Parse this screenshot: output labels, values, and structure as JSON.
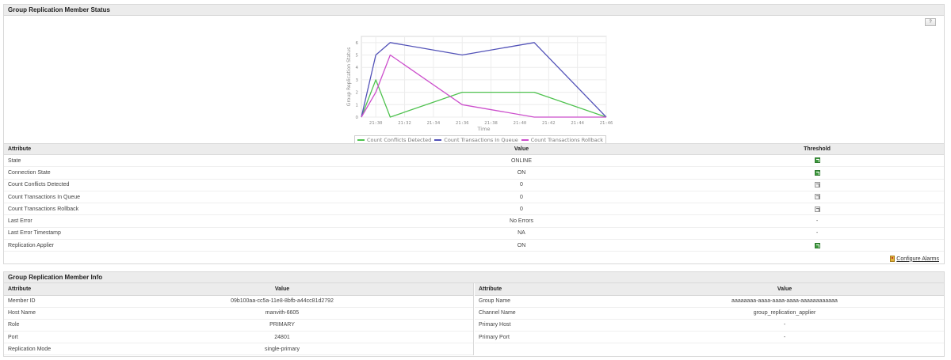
{
  "status_panel": {
    "title": "Group Replication Member Status",
    "export_label": "?"
  },
  "chart_data": {
    "type": "line",
    "ylabel": "Group Replication Status",
    "xlabel": "Time",
    "x_ticks": [
      "21:30",
      "21:32",
      "21:34",
      "21:36",
      "21:38",
      "21:40",
      "21:42",
      "21:44",
      "21:46"
    ],
    "y_ticks": [
      0,
      1,
      2,
      3,
      4,
      5,
      6
    ],
    "ylim": [
      0,
      6.5
    ],
    "x_range_minutes": [
      "21:29",
      "21:46"
    ],
    "grid": true,
    "legend_position": "bottom",
    "series": [
      {
        "name": "Count Conflicts Detected",
        "color": "#4fc24f",
        "points": [
          [
            "21:29",
            0
          ],
          [
            "21:30",
            3
          ],
          [
            "21:31",
            0
          ],
          [
            "21:36",
            2
          ],
          [
            "21:41",
            2
          ],
          [
            "21:46",
            0
          ]
        ]
      },
      {
        "name": "Count Transactions In Queue",
        "color": "#5252b8",
        "points": [
          [
            "21:29",
            0
          ],
          [
            "21:30",
            5
          ],
          [
            "21:31",
            6
          ],
          [
            "21:36",
            5
          ],
          [
            "21:41",
            6
          ],
          [
            "21:46",
            0
          ]
        ]
      },
      {
        "name": "Count Transactions Rollback",
        "color": "#cc4fcc",
        "points": [
          [
            "21:29",
            0
          ],
          [
            "21:30",
            2
          ],
          [
            "21:31",
            5
          ],
          [
            "21:36",
            1
          ],
          [
            "21:41",
            0
          ],
          [
            "21:46",
            0
          ]
        ]
      }
    ]
  },
  "status_table": {
    "headers": {
      "attribute": "Attribute",
      "value": "Value",
      "threshold": "Threshold"
    },
    "rows": [
      {
        "attribute": "State",
        "value": "ONLINE",
        "threshold": "configured"
      },
      {
        "attribute": "Connection State",
        "value": "ON",
        "threshold": "configured"
      },
      {
        "attribute": "Count Conflicts Detected",
        "value": "0",
        "threshold": "not-configured"
      },
      {
        "attribute": "Count Transactions In Queue",
        "value": "0",
        "threshold": "not-configured"
      },
      {
        "attribute": "Count Transactions Rollback",
        "value": "0",
        "threshold": "not-configured"
      },
      {
        "attribute": "Last Error",
        "value": "No Errors",
        "threshold": "-"
      },
      {
        "attribute": "Last Error Timestamp",
        "value": "NA",
        "threshold": "-"
      },
      {
        "attribute": "Replication Applier",
        "value": "ON",
        "threshold": "configured"
      }
    ],
    "configure_alarms_label": "Configure Alarms"
  },
  "info_panel": {
    "title": "Group Replication Member Info",
    "headers": {
      "attribute": "Attribute",
      "value": "Value"
    },
    "left_rows": [
      {
        "attribute": "Member ID",
        "value": "09b100aa-cc5a-11e8-8bfb-a44cc81d2792"
      },
      {
        "attribute": "Host Name",
        "value": "manvith-6605"
      },
      {
        "attribute": "Role",
        "value": "PRIMARY"
      },
      {
        "attribute": "Port",
        "value": "24801"
      },
      {
        "attribute": "Replication Mode",
        "value": "single-primary"
      }
    ],
    "right_rows": [
      {
        "attribute": "Group Name",
        "value": "aaaaaaaa-aaaa-aaaa-aaaa-aaaaaaaaaaaa"
      },
      {
        "attribute": "Channel Name",
        "value": "group_replication_applier"
      },
      {
        "attribute": "Primary Host",
        "value": "-"
      },
      {
        "attribute": "Primary Port",
        "value": "-"
      }
    ]
  }
}
